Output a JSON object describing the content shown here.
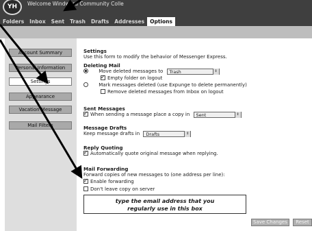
{
  "header": {
    "logo_text": "YH",
    "welcome": "Welcome Windward Community Colle"
  },
  "tabs": [
    {
      "label": "Folders",
      "active": false
    },
    {
      "label": "Inbox",
      "active": false
    },
    {
      "label": "Sent",
      "active": false
    },
    {
      "label": "Trash",
      "active": false
    },
    {
      "label": "Drafts",
      "active": false
    },
    {
      "label": "Addresses",
      "active": false
    },
    {
      "label": "Options",
      "active": true
    }
  ],
  "sidebar": {
    "items": [
      {
        "label": "Account Summary",
        "active": false
      },
      {
        "label": "Personal Information",
        "active": false
      },
      {
        "label": "Settings",
        "active": true
      },
      {
        "label": "Appearance",
        "active": false
      },
      {
        "label": "Vacation Message",
        "active": false
      },
      {
        "label": "Mail Filters",
        "active": false
      }
    ]
  },
  "settings": {
    "title": "Settings",
    "intro": "Use this form to modify the behavior of Messenger Express.",
    "deleting": {
      "heading": "Deleting Mail",
      "move_label": "Move deleted messages to",
      "move_folder": "Trash",
      "empty_label": "Empty folder on logout",
      "mark_label": "Mark messages deleted (use Expunge to delete permanently)",
      "remove_label": "Remove deleted messages from Inbox on logout"
    },
    "sent": {
      "heading": "Sent Messages",
      "label": "When sending a message place a copy in",
      "folder": "Sent"
    },
    "drafts": {
      "heading": "Message Drafts",
      "label": "Keep message drafts in",
      "folder": "Drafts"
    },
    "quoting": {
      "heading": "Reply Quoting",
      "label": "Automatically quote original message when replying."
    },
    "forwarding": {
      "heading": "Mail Forwarding",
      "description": "Forward copies of new messages to (one address per line):",
      "enable_label": "Enable forwarding",
      "leave_copy_label": "Don't leave copy on server",
      "address_text": "type the email address that you\nregularly use in this box"
    }
  },
  "actions": {
    "save": "Save Changes",
    "reset": "Reset"
  },
  "colors": {
    "topbar": "#3f3f3f",
    "band": "#bdbdbd",
    "sidebar": "#dedede",
    "button": "#a9a9a9"
  }
}
